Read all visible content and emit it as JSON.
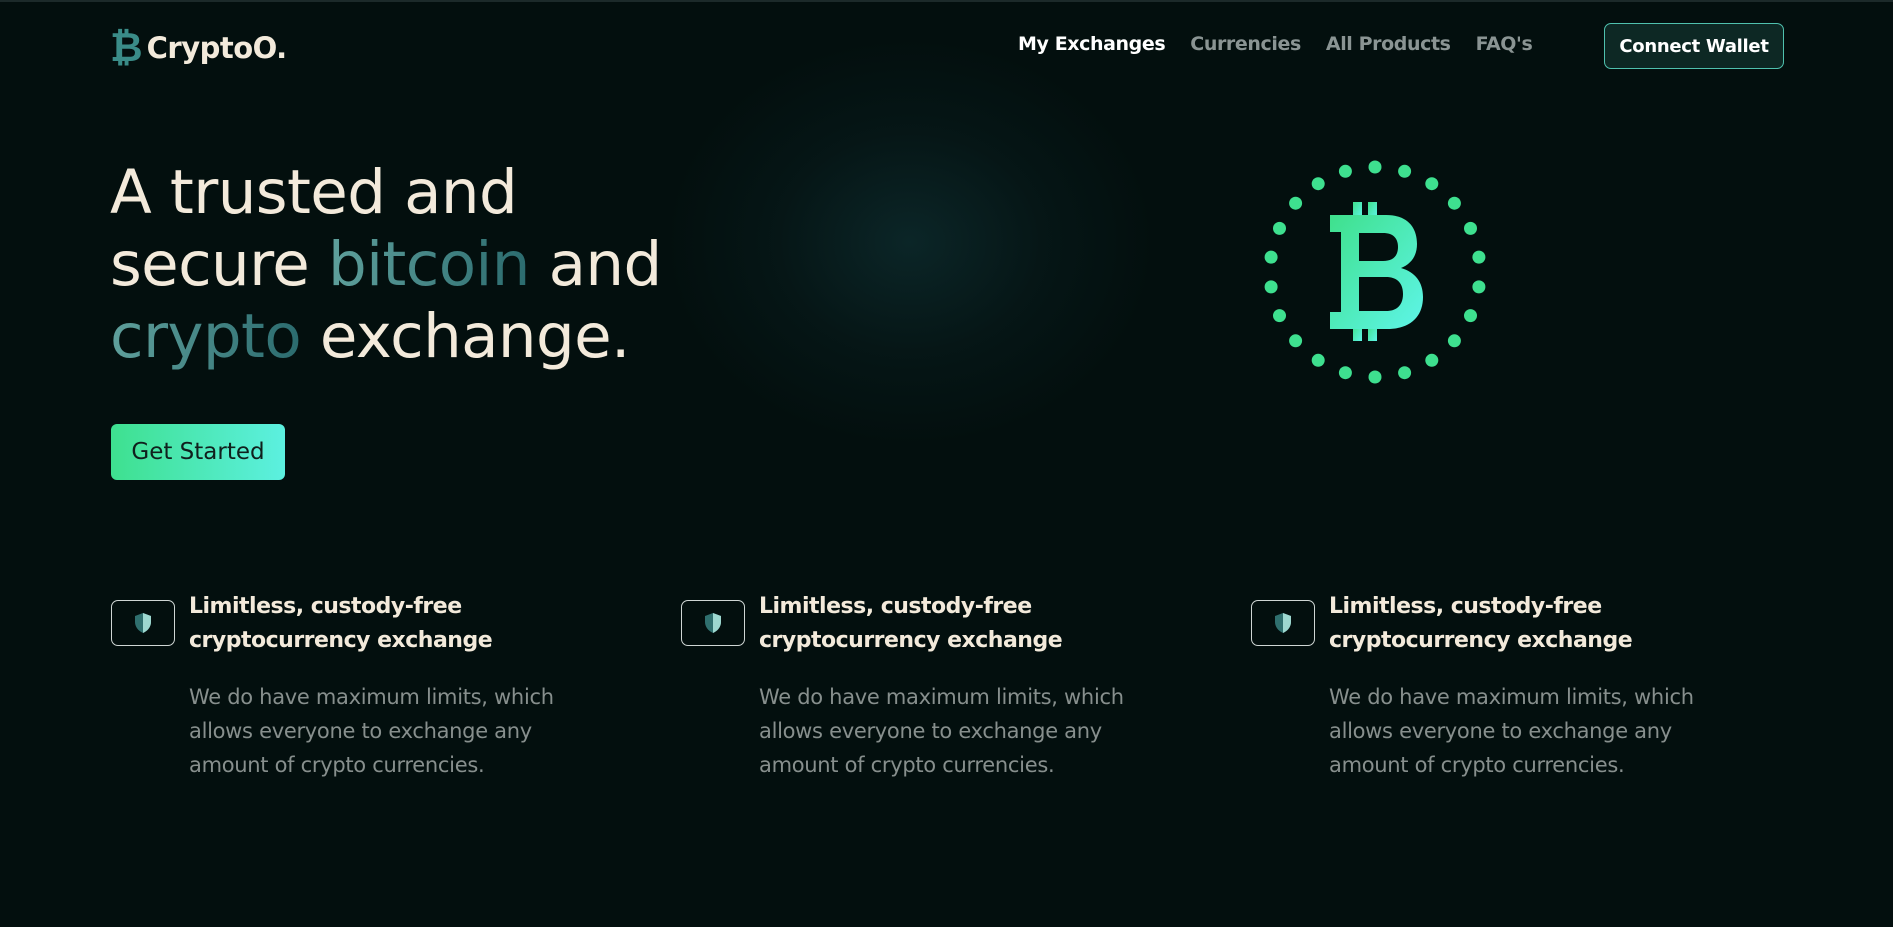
{
  "brand": {
    "logo_glyph": "₿",
    "name": "CryptoO."
  },
  "nav": {
    "items": [
      {
        "label": "My Exchanges",
        "active": true
      },
      {
        "label": "Currencies",
        "active": false
      },
      {
        "label": "All Products",
        "active": false
      },
      {
        "label": "FAQ's",
        "active": false
      }
    ],
    "connect_label": "Connect Wallet"
  },
  "hero": {
    "title_line1": "A trusted and",
    "title_line2_a": "secure ",
    "title_line2_accent": "bitcoin",
    "title_line2_b": " and",
    "title_line3_accent": "crypto",
    "title_line3_b": " exchange.",
    "cta_label": "Get Started",
    "graphic_icon": "bitcoin-circle-icon"
  },
  "features": [
    {
      "icon": "shield-icon",
      "title": "Limitless, custody-free cryptocurrency exchange",
      "description": "We do have maximum limits, which allows everyone to exchange any amount of crypto currencies."
    },
    {
      "icon": "shield-icon",
      "title": "Limitless, custody-free cryptocurrency exchange",
      "description": "We do have maximum limits, which allows everyone to exchange any amount of crypto currencies."
    },
    {
      "icon": "shield-icon",
      "title": "Limitless, custody-free cryptocurrency exchange",
      "description": "We do have maximum limits, which allows everyone to exchange any amount of crypto currencies."
    }
  ],
  "colors": {
    "background": "#030f0e",
    "text_primary": "#f3eadb",
    "accent_green": "#3ee08f",
    "accent_cyan": "#5cf0e0",
    "accent_teal": "#3a8c88",
    "muted": "#878f8d"
  }
}
